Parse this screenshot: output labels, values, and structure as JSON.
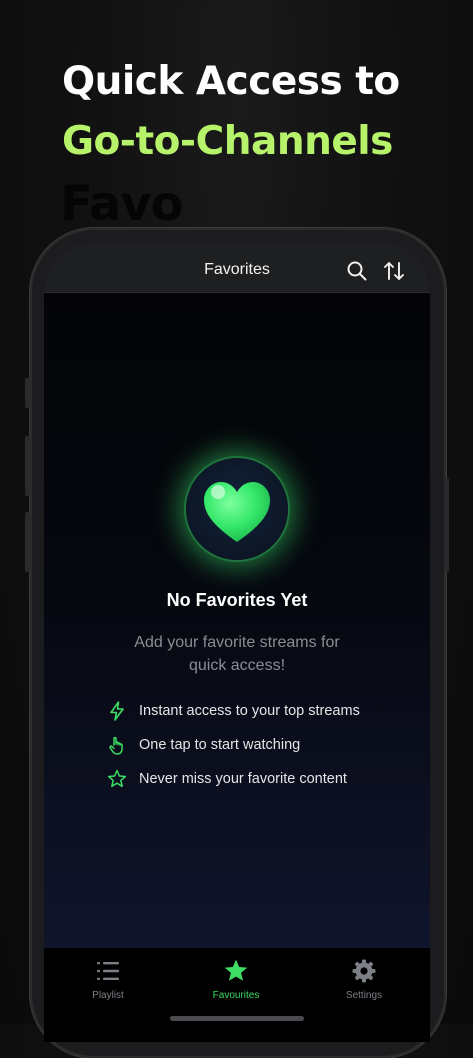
{
  "promo": {
    "line1": "Quick Access to",
    "line2": "Go-to-Channels",
    "ghost": "Favo"
  },
  "navbar": {
    "title": "Favorites",
    "search_icon": "search-icon",
    "sort_icon": "sort-arrows-icon"
  },
  "empty_state": {
    "icon": "heart-icon",
    "title": "No Favorites Yet",
    "subtitle": "Add your favorite streams for quick access!",
    "features": [
      {
        "icon": "bolt-icon",
        "label": "Instant access to your top streams"
      },
      {
        "icon": "tap-hand-icon",
        "label": "One tap to start watching"
      },
      {
        "icon": "star-outline-icon",
        "label": "Never miss your favorite content"
      }
    ]
  },
  "tabbar": {
    "tabs": [
      {
        "label": "Playlist",
        "icon": "list-icon",
        "active": false
      },
      {
        "label": "Favourites",
        "icon": "star-icon",
        "active": true
      },
      {
        "label": "Settings",
        "icon": "gear-icon",
        "active": false
      }
    ]
  },
  "colors": {
    "accent_green": "#3ddc64",
    "headline_green": "#b6f26a",
    "background": "#111111"
  }
}
